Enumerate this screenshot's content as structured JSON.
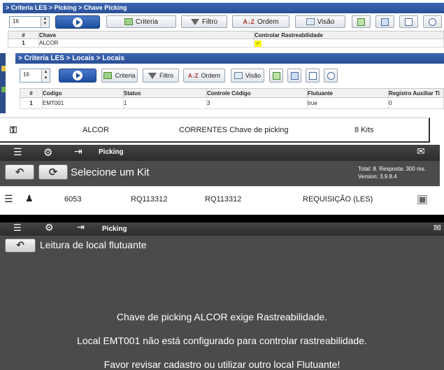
{
  "panel1": {
    "breadcrumb": "> Criteria LES > Picking > Chave Picking",
    "page_size": "16",
    "buttons": {
      "criteria": "Criteria",
      "filtro": "Filtro",
      "ordem": "Ordem",
      "visao": "Visão"
    },
    "columns": [
      "#",
      "Chave",
      "Controlar Rastreabilidade"
    ],
    "rows": [
      {
        "num": "1",
        "chave": "ALCOR",
        "controlar": "✓"
      }
    ]
  },
  "panel2": {
    "breadcrumb": "> Criteria LES > Locais > Locais",
    "page_size": "16",
    "buttons": {
      "criteria": "Criteria",
      "filtro": "Filtro",
      "ordem": "Ordem",
      "visao": "Visão"
    },
    "columns": [
      "#",
      "Codigo",
      "Status",
      "Controle Código",
      "Flutuante",
      "Registro Auxiliar Ti"
    ],
    "rows": [
      {
        "num": "1",
        "codigo": "EMT001",
        "status": "1",
        "controle": "3",
        "flutuante": "true",
        "registro": "0"
      }
    ]
  },
  "kit_row": {
    "icon": "key-icon",
    "name": "ALCOR",
    "description": "CORRENTES Chave de picking",
    "count": "8 Kits"
  },
  "kit_screen": {
    "title": "Picking",
    "heading": "Selecione um Kit",
    "stats_total": "Total: 8. Resposta: 300 ms.",
    "stats_version": "Version: 3.9.8.4",
    "item": {
      "code": "6053",
      "req1": "RQ113312",
      "req2": "RQ113312",
      "type": "REQUISIÇÃO (LES)"
    }
  },
  "message_screen": {
    "title": "Picking",
    "heading": "Leitura de local flutuante",
    "messages": [
      "Chave de picking ALCOR exige Rastreabilidade.",
      "Local EMT001 não está configurado para controlar rastreabilidade.",
      "Favor revisar cadastro ou utilizar outro local Flutuante!"
    ]
  },
  "colors": {
    "breadcrumb_blue": "#2f58a3",
    "check_yellow": "#ffff00",
    "dark_bg": "#4b4b4b",
    "topbar": "#333333"
  }
}
